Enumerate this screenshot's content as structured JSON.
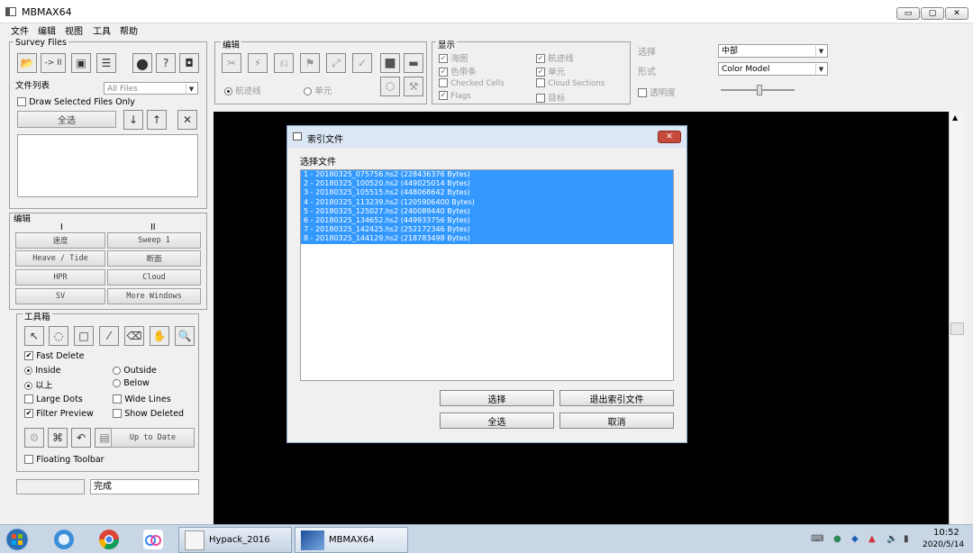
{
  "window": {
    "title": "MBMAX64",
    "min_label": "▭",
    "max_label": "▢",
    "close_label": "✕"
  },
  "menu": [
    "文件",
    "编辑",
    "视图",
    "工具",
    "帮助"
  ],
  "survey_files": {
    "label": "Survey Files",
    "file_list_label": "文件列表",
    "filter_value": "All Files",
    "draw_selected_label": "Draw Selected Files Only",
    "select_all_label": "全选",
    "arrow_label": "-> II"
  },
  "edit_panel": {
    "label": "编辑",
    "col1": "I",
    "col2": "II",
    "buttons": [
      "速度",
      "Sweep 1",
      "Heave / Tide",
      "断面",
      "HPR",
      "Cloud",
      "SV",
      "More Windows"
    ]
  },
  "toolbox": {
    "label": "工具箱",
    "fast_delete": "Fast Delete",
    "inside": "Inside",
    "outside": "Outside",
    "above": "以上",
    "below": "Below",
    "large_dots": "Large Dots",
    "wide_lines": "Wide Lines",
    "filter_preview": "Filter Preview",
    "show_deleted": "Show Deleted",
    "up_to_date": "Up to Date",
    "floating_toolbar": "Floating Toolbar"
  },
  "status": {
    "text": "完成"
  },
  "top_edit": {
    "label": "编辑",
    "track_radio": "航迹线",
    "cell_radio": "单元"
  },
  "display": {
    "label": "显示",
    "items": [
      "海图",
      "航迹线",
      "色带条",
      "单元",
      "Checked Cells",
      "Cloud Sections",
      "Flags",
      "目标"
    ]
  },
  "select_area": {
    "select_label": "选择",
    "select_value": "中部",
    "form_label": "形式",
    "form_value": "Color Model",
    "transparency_label": "透明度"
  },
  "dialog": {
    "title": "索引文件",
    "select_files_label": "选择文件",
    "files": [
      "1 - 20180325_075756.hs2 (228436376 Bytes)",
      "2 - 20180325_100520.hs2 (449025014 Bytes)",
      "3 - 20180325_105515.hs2 (448068642 Bytes)",
      "4 - 20180325_113239.hs2 (1205906400 Bytes)",
      "5 - 20180325_125027.hs2 (240089440 Bytes)",
      "6 - 20180325_134652.hs2 (449933756 Bytes)",
      "7 - 20180325_142425.hs2 (252172346 Bytes)",
      "8 - 20180325_144129.hs2 (218783498 Bytes)"
    ],
    "btn_select": "选择",
    "btn_exit": "退出索引文件",
    "btn_select_all": "全选",
    "btn_cancel": "取消"
  },
  "taskbar": {
    "app1": "Hypack_2016",
    "app2": "MBMAX64",
    "time": "10:52",
    "date": "2020/5/14"
  },
  "colors": {
    "selection": "#3399ff",
    "canvas": "#000000",
    "taskbar": "#c9d6e6"
  }
}
